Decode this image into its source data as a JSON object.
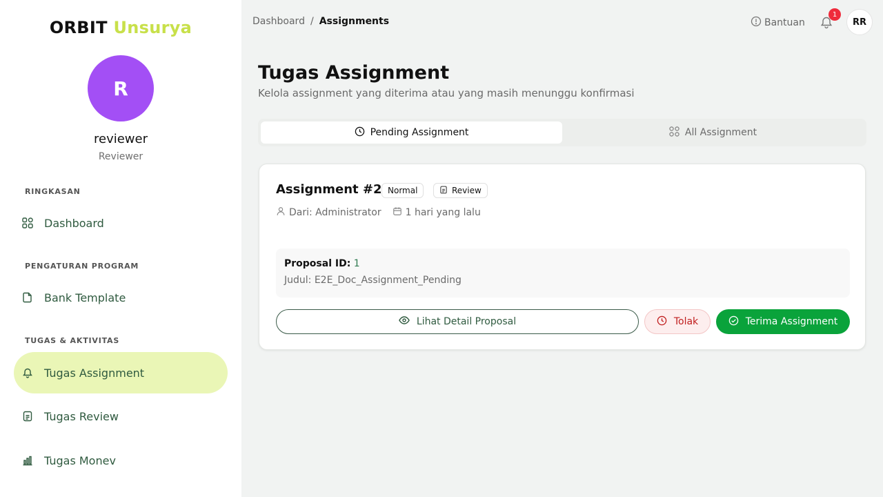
{
  "brand": {
    "part1": "ORBIT",
    "part2": "Unsurya"
  },
  "user": {
    "initial": "R",
    "name": "reviewer",
    "role": "Reviewer",
    "initials": "RR"
  },
  "sidebar": {
    "sections": [
      {
        "label": "RINGKASAN"
      },
      {
        "label": "PENGATURAN PROGRAM"
      },
      {
        "label": "TUGAS & AKTIVITAS"
      }
    ],
    "items": [
      {
        "label": "Dashboard",
        "icon": "grid-icon"
      },
      {
        "label": "Bank Template",
        "icon": "document-icon"
      },
      {
        "label": "Tugas Assignment",
        "icon": "bell-icon",
        "active": true
      },
      {
        "label": "Tugas Review",
        "icon": "file-text-icon"
      },
      {
        "label": "Tugas Monev",
        "icon": "bar-chart-icon"
      }
    ]
  },
  "topbar": {
    "breadcrumb": {
      "root": "Dashboard",
      "separator": "/",
      "current": "Assignments"
    },
    "help_label": "Bantuan",
    "notification_count": "1"
  },
  "page": {
    "title": "Tugas Assignment",
    "subtitle": "Kelola assignment yang diterima atau yang masih menunggu konfirmasi"
  },
  "tabs": [
    {
      "label": "Pending Assignment",
      "active": true
    },
    {
      "label": "All Assignment",
      "active": false
    }
  ],
  "assignment": {
    "title": "Assignment #2",
    "priority": "Normal",
    "type": "Review",
    "from": "Dari: Administrator",
    "time": "1 hari yang lalu",
    "proposal_id_label": "Proposal ID:",
    "proposal_id_value": "1",
    "judul": "Judul: E2E_Doc_Assignment_Pending",
    "actions": {
      "detail": "Lihat Detail Proposal",
      "reject": "Tolak",
      "accept": "Terima Assignment"
    }
  },
  "colors": {
    "accent_green": "#0aa33b",
    "brand_lime": "#c8e04a",
    "avatar_purple": "#a34ff5",
    "active_nav_bg": "#eaf6b6",
    "reject_red": "#c01e1e"
  }
}
